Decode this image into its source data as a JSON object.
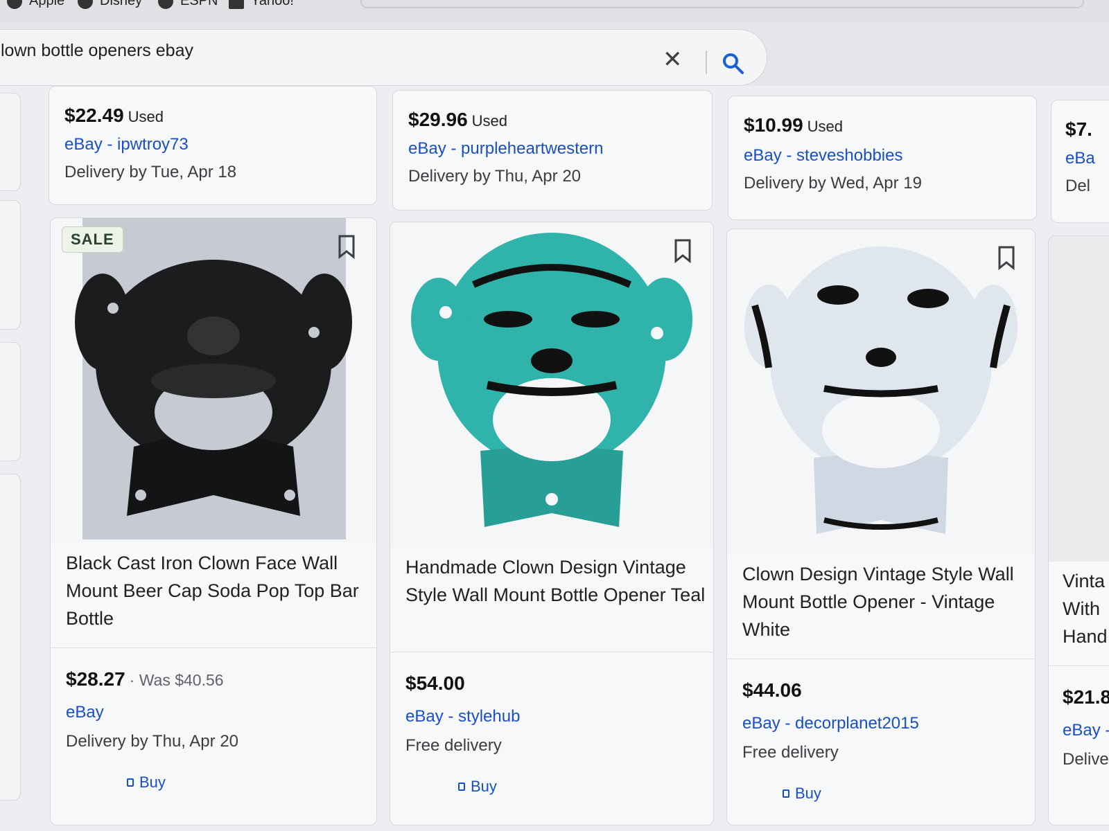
{
  "bookmarks": [
    "Apple",
    "Disney",
    "ESPN",
    "Yahoo!"
  ],
  "search": {
    "query": "lown bottle openers ebay",
    "clear_icon": "close-icon",
    "search_icon": "search-icon"
  },
  "top_row": [
    {
      "price": "$22.49",
      "condition": "Used",
      "seller": "eBay - ipwtroy73",
      "delivery": "Delivery by Tue, Apr 18"
    },
    {
      "price": "$29.96",
      "condition": "Used",
      "seller": "eBay - purpleheartwestern",
      "delivery": "Delivery by Thu, Apr 20"
    },
    {
      "price": "$10.99",
      "condition": "Used",
      "seller": "eBay - steveshobbies",
      "delivery": "Delivery by Wed, Apr 19"
    },
    {
      "price": "$7.",
      "seller": "eBa",
      "delivery": "Del"
    }
  ],
  "products": [
    {
      "badge": "SALE",
      "title": "Black Cast Iron Clown Face Wall Mount Beer Cap Soda Pop Top Bar Bottle",
      "price": "$28.27",
      "was": "· Was $40.56",
      "seller": "eBay",
      "delivery": "Delivery by Thu, Apr 20",
      "buy": "Buy",
      "image_color": "#1c1c1e"
    },
    {
      "title": "Handmade Clown Design Vintage Style Wall Mount Bottle Opener Teal",
      "price": "$54.00",
      "seller": "eBay - stylehub",
      "delivery": "Free delivery",
      "buy": "Buy",
      "image_color": "#2fb3aa"
    },
    {
      "title": "Clown Design Vintage Style Wall Mount Bottle Opener - Vintage White",
      "price": "$44.06",
      "seller": "eBay - decorplanet2015",
      "delivery": "Free delivery",
      "buy": "Buy",
      "image_color": "#dfe6ee"
    },
    {
      "title": "Vinta With Hand",
      "price": "$21.8",
      "seller": "eBay -",
      "delivery": "Delive"
    }
  ],
  "colors": {
    "link": "#1a4fc4",
    "accent_teal": "#2fb3aa"
  }
}
